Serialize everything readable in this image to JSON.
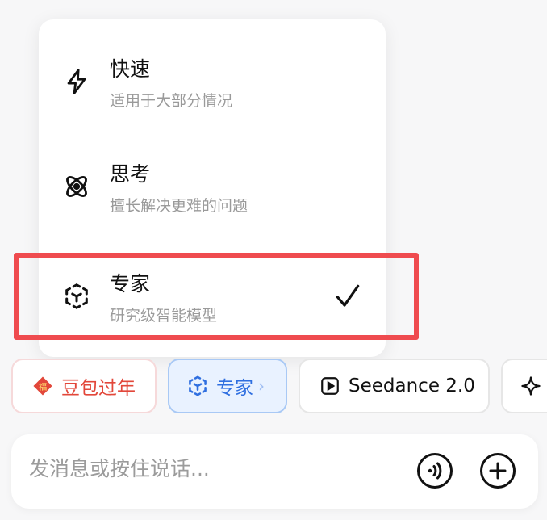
{
  "menu": {
    "items": [
      {
        "title": "快速",
        "subtitle": "适用于大部分情况",
        "icon": "lightning-icon",
        "selected": false
      },
      {
        "title": "思考",
        "subtitle": "擅长解决更难的问题",
        "icon": "atom-icon",
        "selected": false
      },
      {
        "title": "专家",
        "subtitle": "研究级智能模型",
        "icon": "cube-icon",
        "selected": true
      }
    ]
  },
  "chips": {
    "newyear": {
      "label": "豆包过年",
      "icon": "fu-icon"
    },
    "expert": {
      "label": "专家",
      "chevron": "›",
      "icon": "cube-icon"
    },
    "seedance": {
      "label": "Seedance 2.0",
      "icon": "play-icon"
    },
    "more": {
      "icon": "sparkle-icon"
    }
  },
  "input": {
    "placeholder": "发消息或按住说话..."
  },
  "colors": {
    "highlight": "#ef4b4f",
    "accent_blue": "#2f6fe0",
    "newyear_red": "#e2473a"
  }
}
